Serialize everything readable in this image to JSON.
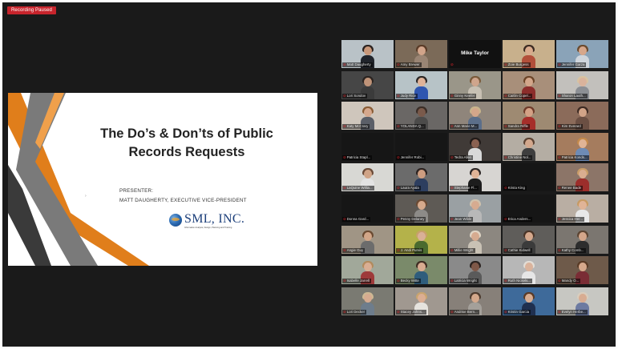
{
  "recording": {
    "label": "Recording Paused"
  },
  "slide": {
    "title": "The Do’s & Don’ts of Public Records Requests",
    "presenter_label": "PRESENTER:",
    "presenter_name": "MATT DAUGHERTY, EXECUTIVE VICE-PRESIDENT",
    "logo_text": "SML, INC.",
    "logo_tagline": "Information Analysis, Design, Planning and Training",
    "colors": {
      "orange": "#e07e1b",
      "grey": "#6f6f6f",
      "dark": "#3a3a3a"
    }
  },
  "gallery": {
    "active_speaker": "Matt Daugherty",
    "participants": [
      {
        "name": "Matt Daugherty",
        "video": true,
        "bg": "#b9c2c7",
        "skin": "#c9987a",
        "hair": "#2b2320",
        "shirt": "#20242b"
      },
      {
        "name": "Amy Brewer",
        "video": true,
        "bg": "#7b6a58",
        "skin": "#d1a48a",
        "hair": "#5a3b27",
        "shirt": "#9a8574"
      },
      {
        "name": "Mike Taylor",
        "video": false,
        "bg": "#111111"
      },
      {
        "name": "Zoie Burgess",
        "video": true,
        "bg": "#c8b08c",
        "skin": "#d9ab8d",
        "hair": "#3b2a22",
        "shirt": "#b24f3a"
      },
      {
        "name": "Jennifer Garza",
        "video": true,
        "bg": "#8aa3b8",
        "skin": "#d7a78b",
        "hair": "#6a4a2e",
        "shirt": "#cfd5dc"
      },
      {
        "name": "Lori Sondov",
        "video": true,
        "bg": "#464646",
        "skin": "#bf9378",
        "hair": "#2a2320",
        "shirt": "#3b3b3b"
      },
      {
        "name": "Judy Rice",
        "video": true,
        "bg": "#b7c3c7",
        "skin": "#e0b399",
        "hair": "#2a2524",
        "shirt": "#2f56b0"
      },
      {
        "name": "Ginny Keefer",
        "video": true,
        "bg": "#9a9689",
        "skin": "#cfa58c",
        "hair": "#7a5a3a",
        "shirt": "#c7c0b3"
      },
      {
        "name": "Caitlin Copel...",
        "video": true,
        "bg": "#a88f7a",
        "skin": "#d3a68a",
        "hair": "#6b4428",
        "shirt": "#8c2d2b"
      },
      {
        "name": "Sharon Lauth...",
        "video": true,
        "bg": "#c2c0bc",
        "skin": "#dab39c",
        "hair": "#d8c3a0",
        "shirt": "#8c8f94"
      },
      {
        "name": "Katy McCrary",
        "video": true,
        "bg": "#cfc6bc",
        "skin": "#d6a88d",
        "hair": "#8a5c35",
        "shirt": "#5b5f68"
      },
      {
        "name": "YOLANDA Q...",
        "video": true,
        "bg": "#6a6765",
        "skin": "#7a5a4b",
        "hair": "#3a2d26",
        "shirt": "#4c4b4a"
      },
      {
        "name": "Ann Marie M...",
        "video": true,
        "bg": "#8f857b",
        "skin": "#d3a68a",
        "hair": "#c9b48c",
        "shirt": "#5b6e8a"
      },
      {
        "name": "Sandra Riffle",
        "video": true,
        "bg": "#9e8a72",
        "skin": "#d4a185",
        "hair": "#6e3b2a",
        "shirt": "#a62e2a"
      },
      {
        "name": "Kim Everard",
        "video": true,
        "bg": "#8b6b5a",
        "skin": "#d2a488",
        "hair": "#3d2a23",
        "shirt": "#6b4f43"
      },
      {
        "name": "Patricia Stapl...",
        "video": false,
        "bg": "#161616"
      },
      {
        "name": "Jennifer Robi...",
        "video": false,
        "bg": "#161616"
      },
      {
        "name": "Tedra Allen",
        "video": true,
        "bg": "#403a37",
        "skin": "#8a6151",
        "hair": "#201a18",
        "shirt": "#d9d9d9"
      },
      {
        "name": "Christine Nol...",
        "video": true,
        "bg": "#b4ada3",
        "skin": "#d3a88d",
        "hair": "#5b4232",
        "shirt": "#3e3e3e"
      },
      {
        "name": "Patricia Konds...",
        "video": true,
        "bg": "#a57c5e",
        "skin": "#e0b496",
        "hair": "#c58a4a",
        "shirt": "#6e8bb5"
      },
      {
        "name": "LaQuine Willia...",
        "video": true,
        "bg": "#d8d8d4",
        "skin": "#d0a487",
        "hair": "#6a4b38",
        "shirt": "#e3e3e3"
      },
      {
        "name": "Laura Ayala",
        "video": true,
        "bg": "#6b6b6b",
        "skin": "#cd9d80",
        "hair": "#2b2220",
        "shirt": "#2d3e5f"
      },
      {
        "name": "Stephanie Fl...",
        "video": true,
        "bg": "#d7d5d2",
        "skin": "#e0b497",
        "hair": "#2b2524",
        "shirt": "#1d1d1d"
      },
      {
        "name": "Krista King",
        "video": false,
        "bg": "#161616"
      },
      {
        "name": "Renee Bade",
        "video": true,
        "bg": "#8c7568",
        "skin": "#d9ad90",
        "hair": "#c99d67",
        "shirt": "#9c2e2b"
      },
      {
        "name": "Donna Gard...",
        "video": false,
        "bg": "#161616"
      },
      {
        "name": "Penny Delaney",
        "video": true,
        "bg": "#5e5a55",
        "skin": "#d5a98c",
        "hair": "#6b4a33",
        "shirt": "#8d8b88"
      },
      {
        "name": "Jean Wible",
        "video": true,
        "bg": "#9aa0a3",
        "skin": "#d6ab90",
        "hair": "#d0c2ac",
        "shirt": "#b8b8b8"
      },
      {
        "name": "Erica Anders...",
        "video": false,
        "bg": "#161616"
      },
      {
        "name": "Jessica Her...",
        "video": true,
        "bg": "#b9aea3",
        "skin": "#e0b497",
        "hair": "#c79a62",
        "shirt": "#e8e8e8"
      },
      {
        "name": "Angie Guy",
        "video": true,
        "bg": "#a09585",
        "skin": "#d2a688",
        "hair": "#6a4a31",
        "shirt": "#6c6c6c"
      },
      {
        "name": "J. Andi Purvis",
        "video": true,
        "bg": "#b4b24a",
        "skin": "#d9b097",
        "hair": "#c7a06a",
        "shirt": "#4a6a2e"
      },
      {
        "name": "Millie Wright",
        "video": true,
        "bg": "#8c8780",
        "skin": "#d6ab90",
        "hair": "#e0d5c5",
        "shirt": "#c9c2b5"
      },
      {
        "name": "Cathie Kidwell",
        "video": true,
        "bg": "#5f5d5a",
        "skin": "#d6a98d",
        "hair": "#4a3528",
        "shirt": "#3b3b3b"
      },
      {
        "name": "Kathy Comb...",
        "video": true,
        "bg": "#7b7670",
        "skin": "#d4a68a",
        "hair": "#5c4432",
        "shirt": "#2d2d2d"
      },
      {
        "name": "Isabelle Jarrell",
        "video": true,
        "bg": "#a1a89a",
        "skin": "#d9ae93",
        "hair": "#b18a5d",
        "shirt": "#9e3a3a"
      },
      {
        "name": "Becky Witte",
        "video": true,
        "bg": "#7a8a6a",
        "skin": "#d8ab90",
        "hair": "#3f2d23",
        "shirt": "#2f5d7c"
      },
      {
        "name": "Latricia Wright",
        "video": true,
        "bg": "#8a8a8a",
        "skin": "#7e5848",
        "hair": "#2a221f",
        "shirt": "#5a5a5a"
      },
      {
        "name": "Ruth Nickels...",
        "video": true,
        "bg": "#b7b7b7",
        "skin": "#dab39c",
        "hair": "#e2ddd6",
        "shirt": "#e6e6e6"
      },
      {
        "name": "Mandy O...",
        "video": true,
        "bg": "#6e5a4a",
        "skin": "#d7a98c",
        "hair": "#5a3b26",
        "shirt": "#7a2d35"
      },
      {
        "name": "Lori Decker",
        "video": true,
        "bg": "#7a7a72",
        "skin": "#d6ab90",
        "hair": "#cdb893",
        "shirt": "#6e7d8c"
      },
      {
        "name": "Stacey Johns...",
        "video": true,
        "bg": "#a09890",
        "skin": "#dcae93",
        "hair": "#c9a46e",
        "shirt": "#e6e3de"
      },
      {
        "name": "Andrise Bern...",
        "video": true,
        "bg": "#878079",
        "skin": "#d4a88b",
        "hair": "#4e3b2e",
        "shirt": "#a4a09a"
      },
      {
        "name": "Kristin Garcia",
        "video": true,
        "bg": "#3e6a9a",
        "skin": "#d8ac90",
        "hair": "#5a3a26",
        "shirt": "#1f2f4f"
      },
      {
        "name": "Evelyn Herbe...",
        "video": true,
        "bg": "#c7c7c2",
        "skin": "#d8ac92",
        "hair": "#d9cdbd",
        "shirt": "#6c7aa1"
      }
    ]
  }
}
